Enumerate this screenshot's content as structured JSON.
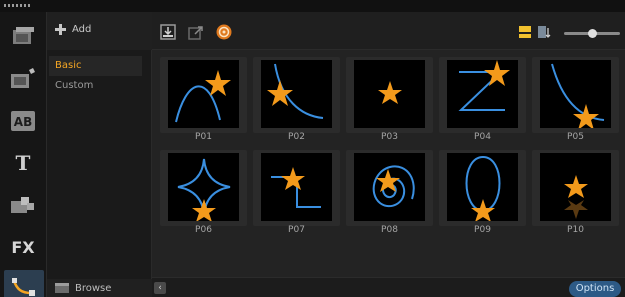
{
  "window": {
    "grip_label": ""
  },
  "tools": [
    {
      "name": "media-icon",
      "active": false
    },
    {
      "name": "instant-project-icon",
      "active": false
    },
    {
      "name": "title-ab-icon",
      "active": false,
      "text": "AB"
    },
    {
      "name": "text-tool-icon",
      "active": false,
      "text": "T"
    },
    {
      "name": "graphics-icon",
      "active": false
    },
    {
      "name": "fx-icon",
      "active": false,
      "text": "FX"
    },
    {
      "name": "path-icon",
      "active": true
    }
  ],
  "categories": {
    "add_label": "Add",
    "items": [
      {
        "label": "Basic",
        "selected": true
      },
      {
        "label": "Custom",
        "selected": false
      }
    ],
    "browse_label": "Browse"
  },
  "toolbar": {
    "options_label": "Options"
  },
  "paths": [
    {
      "label": "P01"
    },
    {
      "label": "P02"
    },
    {
      "label": "P03"
    },
    {
      "label": "P04"
    },
    {
      "label": "P05"
    },
    {
      "label": "P06"
    },
    {
      "label": "P07"
    },
    {
      "label": "P08"
    },
    {
      "label": "P09"
    },
    {
      "label": "P10"
    }
  ],
  "colors": {
    "accent": "#f5a623",
    "path_line": "#3a8fe0",
    "star": "#f39a1b"
  },
  "zoom_level": 0.5
}
